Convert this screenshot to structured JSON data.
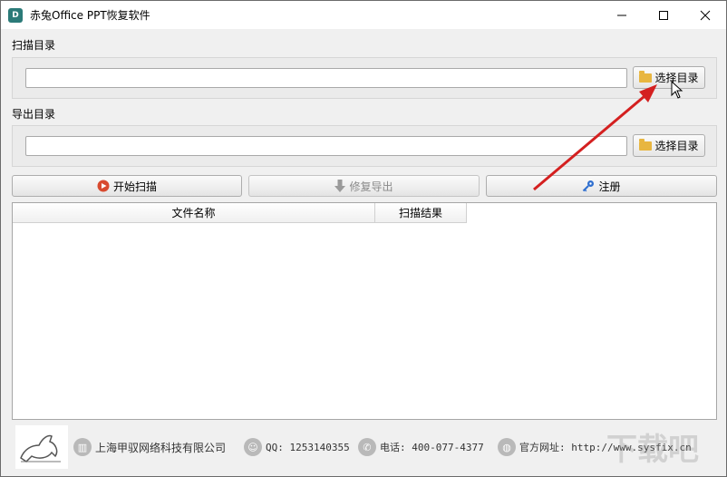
{
  "window": {
    "title": "赤兔Office PPT恢复软件",
    "app_icon_letter": "D"
  },
  "scan_section": {
    "label": "扫描目录",
    "input_value": "",
    "button_label": "选择目录"
  },
  "export_section": {
    "label": "导出目录",
    "input_value": "",
    "button_label": "选择目录"
  },
  "actions": {
    "start_scan": "开始扫描",
    "repair_export": "修复导出",
    "register": "注册"
  },
  "table": {
    "columns": [
      "文件名称",
      "扫描结果"
    ],
    "rows": []
  },
  "footer": {
    "company": "上海甲驭网络科技有限公司",
    "qq": "QQ: 1253140355",
    "phone": "电话: 400-077-4377",
    "website": "官方网址: http://www.sysfix.cn"
  },
  "colors": {
    "accent_red": "#d42020",
    "window_bg": "#f0f0f0",
    "folder_yellow": "#e8b640",
    "key_blue": "#2f6fcf"
  }
}
